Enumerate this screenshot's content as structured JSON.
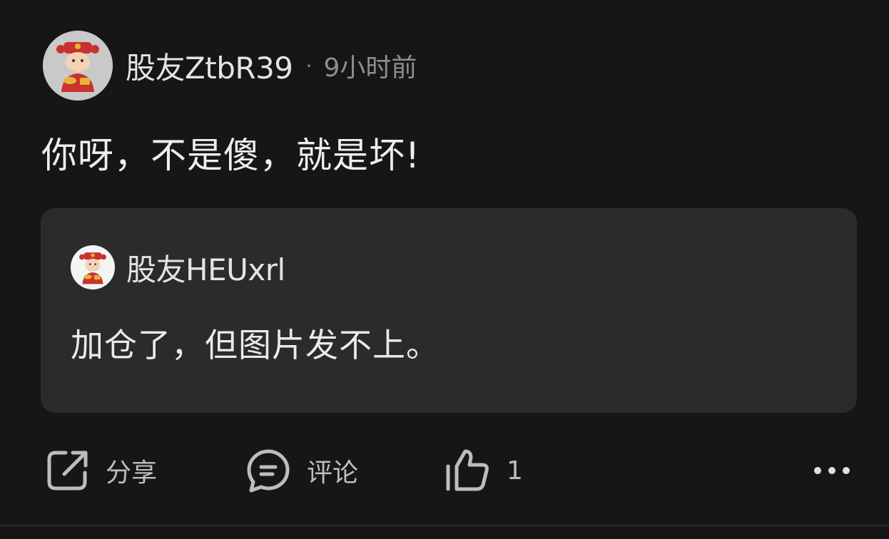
{
  "post": {
    "author": "股友ZtbR39",
    "separator": "·",
    "time": "9小时前",
    "content": "你呀，不是傻，就是坏!",
    "avatar_icon": "fortune-god-avatar"
  },
  "quote": {
    "author": "股友HEUxrl",
    "content": "加仓了，但图片发不上。",
    "avatar_icon": "fortune-god-avatar"
  },
  "actions": {
    "share_label": "分享",
    "comment_label": "评论",
    "like_count": "1",
    "share_icon": "share-icon",
    "comment_icon": "comment-icon",
    "like_icon": "thumbs-up-icon",
    "more_icon": "more-icon"
  },
  "colors": {
    "background": "#161616",
    "quote_background": "#2b2b2d",
    "text": "#eeeeee",
    "muted": "#8e8e8e"
  }
}
